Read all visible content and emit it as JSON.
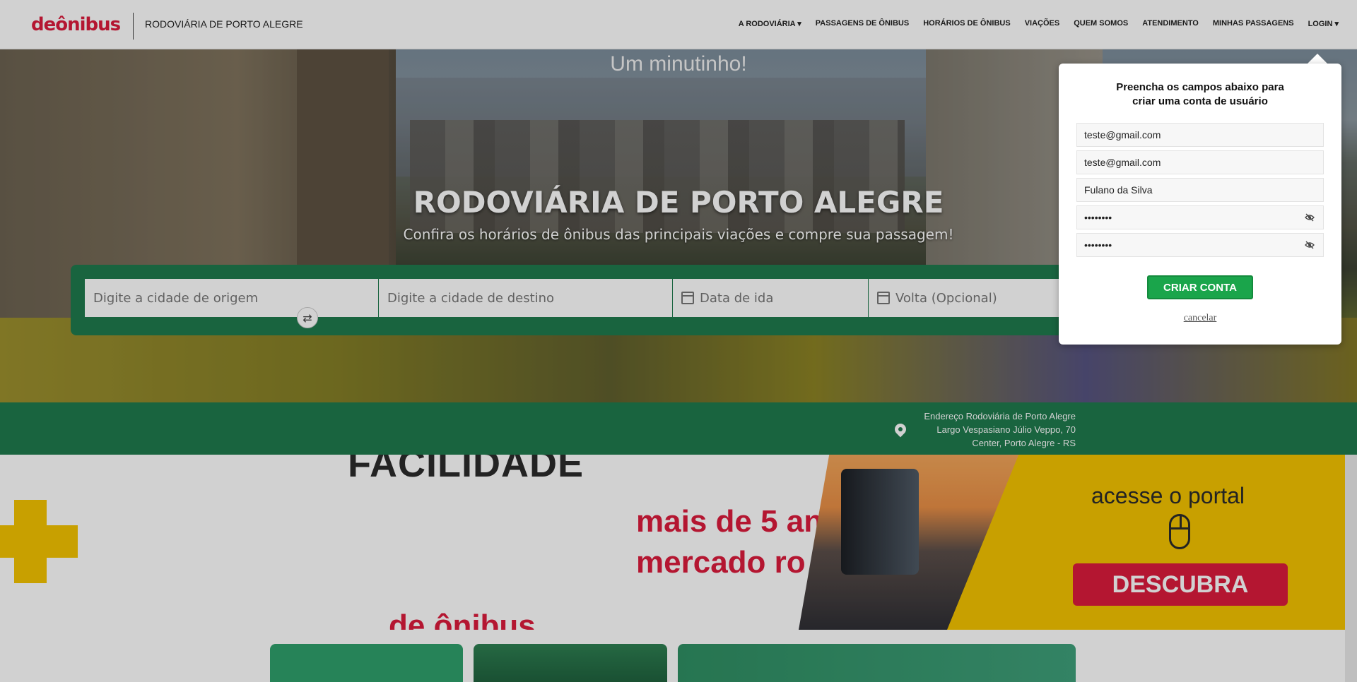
{
  "header": {
    "logo": "deônibus",
    "site_name": "RODOVIÁRIA DE PORTO ALEGRE",
    "nav": [
      {
        "label": "A RODOVIÁRIA ▾"
      },
      {
        "label": "PASSAGENS DE ÔNIBUS"
      },
      {
        "label": "HORÁRIOS DE ÔNIBUS"
      },
      {
        "label": "VIAÇÕES"
      },
      {
        "label": "QUEM SOMOS"
      },
      {
        "label": "ATENDIMENTO"
      },
      {
        "label": "MINHAS PASSAGENS"
      },
      {
        "label": "LOGIN ▾"
      }
    ]
  },
  "hero": {
    "wait_text": "Um minutinho!",
    "title": "RODOVIÁRIA DE PORTO ALEGRE",
    "subtitle": "Confira os horários de ônibus das principais viações e compre sua passagem!"
  },
  "search": {
    "origin_placeholder": "Digite a cidade de origem",
    "destination_placeholder": "Digite a cidade de destino",
    "departure_placeholder": "Data de ida",
    "return_placeholder": "Volta (Opcional)",
    "swap_icon": "⇄"
  },
  "address": {
    "line1": "Endereço Rodoviária de Porto Alegre",
    "line2": "Largo Vespasiano Júlio Veppo, 70",
    "line3": "Center, Porto Alegre - RS"
  },
  "banner": {
    "headline": "FACILIDADE",
    "red_text_line1": "mais de 5 an",
    "red_text_line2": "mercado ro",
    "bottom_red_text": "de ônibus",
    "portal_text": "acesse o portal",
    "button_label": "DESCUBRA"
  },
  "signup": {
    "title_line1": "Preencha os campos abaixo para",
    "title_line2": "criar uma conta de usuário",
    "email": "teste@gmail.com",
    "email_confirm": "teste@gmail.com",
    "name": "Fulano da Silva",
    "password_mask": "••••••••",
    "password_confirm_mask": "••••••••",
    "submit_label": "CRIAR CONTA",
    "cancel_label": "cancelar"
  },
  "colors": {
    "brand_red": "#dc1c3c",
    "brand_green": "#1f7a4e",
    "button_green": "#1aa54b",
    "banner_yellow": "#f5c400"
  }
}
